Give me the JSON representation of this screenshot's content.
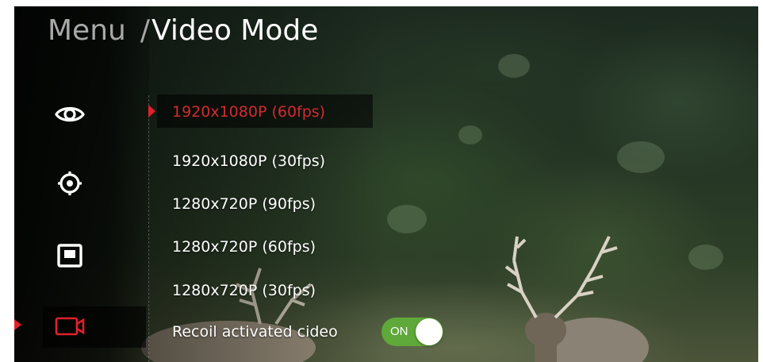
{
  "header": {
    "breadcrumb_root": "Menu",
    "separator": "/",
    "current": "Video Mode"
  },
  "sidebar": {
    "items": [
      {
        "icon": "eye-icon",
        "active": false
      },
      {
        "icon": "crosshair-icon",
        "active": false
      },
      {
        "icon": "display-frame-icon",
        "active": false
      },
      {
        "icon": "video-camera-icon",
        "active": true
      }
    ]
  },
  "video_modes": {
    "options": [
      {
        "label": "1920x1080P (60fps)",
        "selected": true
      },
      {
        "label": "1920x1080P (30fps)",
        "selected": false
      },
      {
        "label": "1280x720P (90fps)",
        "selected": false
      },
      {
        "label": "1280x720P (60fps)",
        "selected": false
      },
      {
        "label": "1280x720P (30fps)",
        "selected": false
      }
    ]
  },
  "recoil": {
    "label": "Recoil activated cideo",
    "toggle_state": "ON"
  },
  "colors": {
    "accent": "#e0202a",
    "selected_text": "#d42a2f",
    "toggle_on": "#5fa83a",
    "inactive_text": "#a8a8a8"
  }
}
